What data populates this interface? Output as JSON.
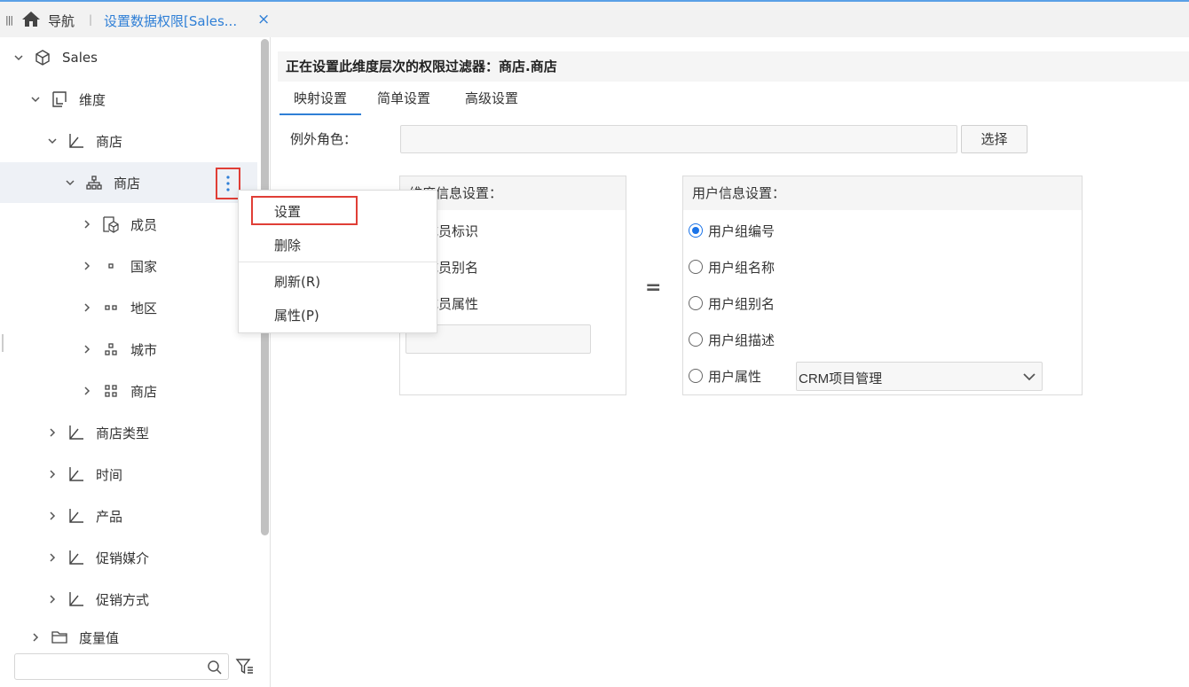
{
  "topbar": {
    "menu_icon": "|||",
    "nav_label": "导航",
    "separator": "|",
    "tab_label": "设置数据权限[Sales...",
    "tab_close": "×"
  },
  "tree": {
    "root": "Sales",
    "dimension_group": "维度",
    "store": "商店",
    "store_hierarchy": "商店",
    "members": "成员",
    "level_country": "国家",
    "level_region": "地区",
    "level_city": "城市",
    "level_store": "商店",
    "store_type": "商店类型",
    "time": "时间",
    "product": "产品",
    "promo_media": "促销媒介",
    "promo_method": "促销方式",
    "measures": "度量值"
  },
  "search": {
    "value": ""
  },
  "context_menu": {
    "items": [
      "设置",
      "删除",
      "刷新(R)",
      "属性(P)"
    ]
  },
  "right": {
    "header": "正在设置此维度层次的权限过滤器：商店.商店",
    "tabs": [
      "映射设置",
      "简单设置",
      "高级设置"
    ],
    "exception_role_label": "例外角色：",
    "select_button": "选择",
    "dim_box": {
      "title": "维度信息设置：",
      "options": [
        "成员标识",
        "成员别名",
        "成员属性"
      ]
    },
    "equals": "=",
    "user_box": {
      "title": "用户信息设置：",
      "options": [
        "用户组编号",
        "用户组名称",
        "用户组别名",
        "用户组描述",
        "用户属性"
      ],
      "selected_index": 0,
      "attr_select_value": "CRM项目管理"
    }
  },
  "colors": {
    "accent": "#2f7fd6",
    "highlight_border": "#e03e36",
    "radio_checked": "#1a73e8"
  }
}
